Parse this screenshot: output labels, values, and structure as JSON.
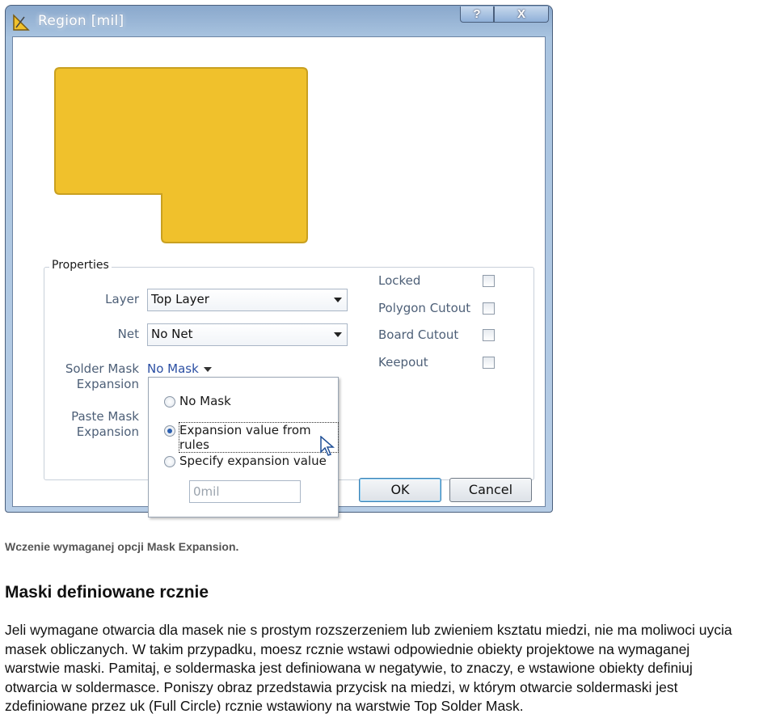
{
  "window": {
    "title": "Region [mil]",
    "help_label": "?",
    "close_label": "X",
    "title_icon": "region-icon"
  },
  "preview": {
    "fill_color": "#f0c12c",
    "stroke_color": "#c9a020"
  },
  "properties": {
    "group_label": "Properties",
    "layer_label": "Layer",
    "layer_value": "Top Layer",
    "net_label": "Net",
    "net_value": "No Net",
    "solder_mask_label_1": "Solder Mask",
    "solder_mask_label_2": "Expansion",
    "solder_mask_value": "No Mask",
    "paste_mask_label_1": "Paste Mask",
    "paste_mask_label_2": "Expansion",
    "checkboxes": [
      {
        "label": "Locked",
        "checked": false
      },
      {
        "label": "Polygon Cutout",
        "checked": false
      },
      {
        "label": "Board Cutout",
        "checked": false
      },
      {
        "label": "Keepout",
        "checked": false
      }
    ]
  },
  "popup": {
    "options": [
      {
        "label": "No Mask",
        "selected": false
      },
      {
        "label": "Expansion value from rules",
        "selected": true
      },
      {
        "label": "Specify expansion value",
        "selected": false
      }
    ],
    "value_placeholder": "0mil"
  },
  "buttons": {
    "ok": "OK",
    "cancel": "Cancel"
  },
  "article": {
    "caption": "Wczenie wymaganej opcji Mask Expansion.",
    "heading": "Maski definiowane rcznie",
    "lines": [
      "Jeli wymagane otwarcia dla masek nie s prostym rozszerzeniem lub zwieniem ksztatu miedzi, nie ma moliwoci uycia",
      "masek obliczanych. W takim przypadku, moesz rcznie wstawi odpowiednie obiekty projektowe na wymaganej",
      "warstwie maski. Pamitaj, e soldermaska jest definiowana w negatywie, to znaczy, e wstawione obiekty definiuj",
      "otwarcia w soldermasce. Poniszy obraz przedstawia przycisk na miedzi, w którym otwarcie soldermaski jest",
      "zdefiniowane przez uk (Full Circle) rcznie wstawiony na warstwie Top Solder Mask."
    ]
  }
}
